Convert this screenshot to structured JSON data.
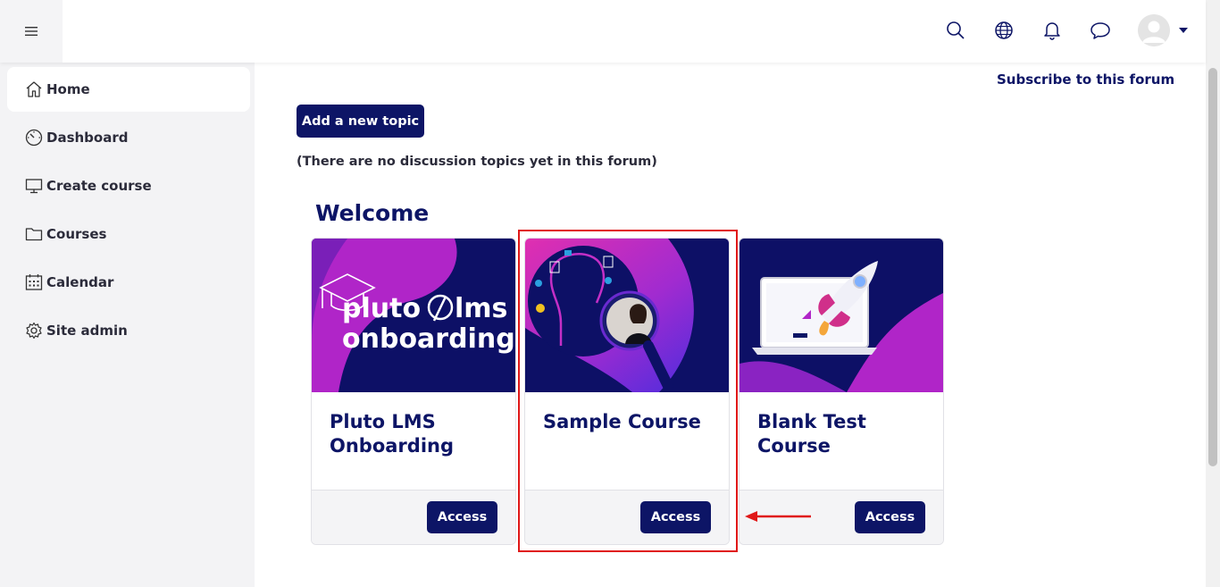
{
  "sidebar": {
    "items": [
      {
        "label": "Home",
        "icon": "home-icon",
        "active": true
      },
      {
        "label": "Dashboard",
        "icon": "dashboard-icon"
      },
      {
        "label": "Create course",
        "icon": "monitor-icon"
      },
      {
        "label": "Courses",
        "icon": "folder-icon"
      },
      {
        "label": "Calendar",
        "icon": "calendar-icon"
      },
      {
        "label": "Site admin",
        "icon": "gear-icon"
      }
    ]
  },
  "forum": {
    "subscribe_label": "Subscribe to this forum",
    "add_topic_label": "Add a new topic",
    "empty_message": "(There are no discussion topics yet in this forum)"
  },
  "welcome_heading": "Welcome",
  "courses": [
    {
      "title": "Pluto LMS Onboarding",
      "access_label": "Access",
      "banner_text_1": "pluto",
      "banner_text_2": "lms",
      "banner_text_3": "onboarding"
    },
    {
      "title": "Sample Course",
      "access_label": "Access"
    },
    {
      "title": "Blank Test Course",
      "access_label": "Access"
    }
  ],
  "colors": {
    "brand": "#0d1566",
    "highlight": "#e01818",
    "banner_purple": "#b025c8"
  }
}
